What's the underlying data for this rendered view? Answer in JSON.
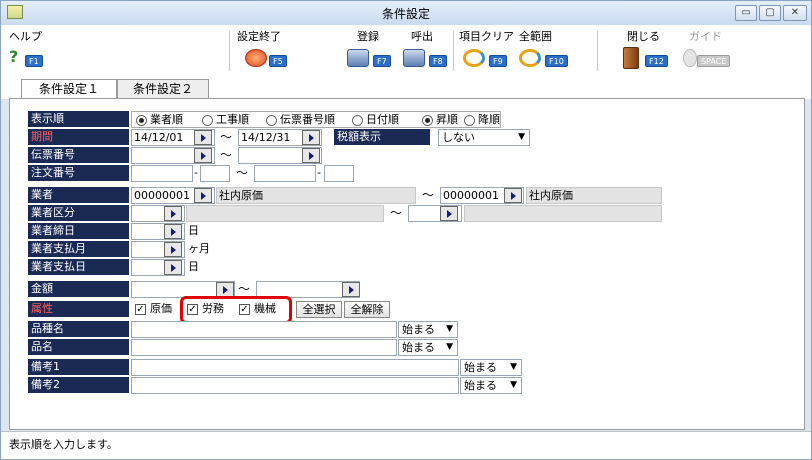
{
  "window": {
    "title": "条件設定",
    "buttons": {
      "minimize": "▭",
      "maximize": "▢",
      "close": "✕"
    }
  },
  "toolbar": {
    "help": {
      "label": "ヘルプ",
      "key": "F1"
    },
    "settings_done": {
      "label": "設定終了",
      "key": "F5",
      "icon": "ok-icon"
    },
    "register": {
      "label": "登録",
      "key": "F7"
    },
    "recall": {
      "label": "呼出",
      "key": "F8"
    },
    "clear_item": {
      "label": "項目クリア",
      "key": "F9"
    },
    "all_range": {
      "label": "全範囲",
      "key": "F10"
    },
    "close": {
      "label": "閉じる",
      "key": "F12"
    },
    "guide": {
      "label": "ガイド",
      "key": "SPACE"
    }
  },
  "tabs": [
    {
      "label": "条件設定１",
      "active": true
    },
    {
      "label": "条件設定２",
      "active": false
    }
  ],
  "form": {
    "sort_order": {
      "label": "表示順",
      "options": [
        "業者順",
        "工事順",
        "伝票番号順",
        "日付順"
      ],
      "selected": "業者順",
      "direction_options": [
        "昇順",
        "降順"
      ],
      "direction_selected": "昇順"
    },
    "period": {
      "label": "期間",
      "from": "14/12/01",
      "to": "14/12/31",
      "tax_label": "税額表示",
      "tax_value": "しない"
    },
    "slip_no": {
      "label": "伝票番号"
    },
    "order_no": {
      "label": "注文番号",
      "sep": "-"
    },
    "vendor": {
      "label": "業者",
      "from_code": "00000001",
      "from_name": "社内原価",
      "to_code": "00000001",
      "to_name": "社内原価"
    },
    "vendor_class": {
      "label": "業者区分"
    },
    "vendor_close_day": {
      "label": "業者締日",
      "unit": "日"
    },
    "vendor_pay_month": {
      "label": "業者支払月",
      "unit": "ヶ月"
    },
    "vendor_pay_day": {
      "label": "業者支払日",
      "unit": "日"
    },
    "amount": {
      "label": "金額"
    },
    "attribute": {
      "label": "属性",
      "checks": [
        {
          "label": "原価",
          "checked": true
        },
        {
          "label": "労務",
          "checked": true
        },
        {
          "label": "機械",
          "checked": true
        }
      ],
      "select_all": "全選択",
      "clear_all": "全解除"
    },
    "category_name": {
      "label": "品種名",
      "match": "始まる"
    },
    "item_name": {
      "label": "品名",
      "match": "始まる"
    },
    "note1": {
      "label": "備考1",
      "match": "始まる"
    },
    "note2": {
      "label": "備考2",
      "match": "始まる"
    },
    "tilde": "～"
  },
  "status": {
    "message": "表示順を入力します。"
  },
  "colors": {
    "label_bg": "#1a2a55",
    "highlight": "#e00000",
    "fkey": "#2b6fc8"
  }
}
